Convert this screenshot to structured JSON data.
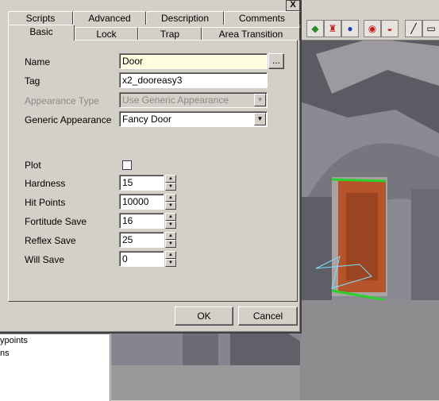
{
  "dialog": {
    "tabs_row1": [
      "Scripts",
      "Advanced",
      "Description",
      "Comments"
    ],
    "tabs_row2": [
      "Basic",
      "Lock",
      "Trap",
      "Area Transition"
    ],
    "fields": {
      "name_label": "Name",
      "name_value": "Door",
      "browse_label": "...",
      "tag_label": "Tag",
      "tag_value": "x2_dooreasy3",
      "appearance_type_label": "Appearance Type",
      "appearance_type_value": "Use Generic Appearance",
      "generic_appearance_label": "Generic Appearance",
      "generic_appearance_value": "Fancy Door",
      "plot_label": "Plot",
      "hardness_label": "Hardness",
      "hardness_value": "15",
      "hit_points_label": "Hit Points",
      "hit_points_value": "10000",
      "fortitude_label": "Fortitude Save",
      "fortitude_value": "16",
      "reflex_label": "Reflex Save",
      "reflex_value": "25",
      "will_label": "Will Save",
      "will_value": "0"
    },
    "ok_label": "OK",
    "cancel_label": "Cancel",
    "close_label": "X"
  },
  "tree": {
    "items": [
      "ypoints",
      "ns"
    ]
  },
  "colors": {
    "door_wood": "#b5542a",
    "selection_green": "#2bd02b"
  }
}
